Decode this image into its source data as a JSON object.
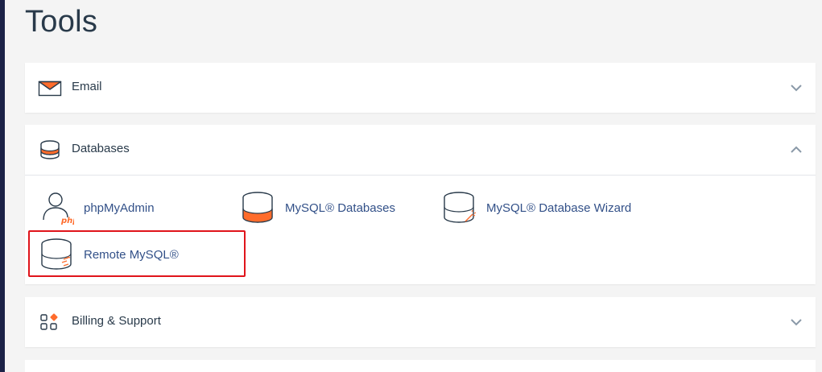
{
  "page": {
    "title": "Tools"
  },
  "colors": {
    "accent_orange": "#ff6c2c",
    "link_blue": "#325088",
    "highlight_red": "#e0141b",
    "left_rail": "#1c2247"
  },
  "sections": {
    "email": {
      "title": "Email",
      "icon": "envelope-icon",
      "state": "collapsed"
    },
    "databases": {
      "title": "Databases",
      "icon": "database-stack-icon",
      "state": "expanded",
      "tools": [
        {
          "label": "phpMyAdmin",
          "icon": "phpmyadmin-user-icon"
        },
        {
          "label": "MySQL® Databases",
          "icon": "mysql-databases-icon"
        },
        {
          "label": "MySQL® Database Wizard",
          "icon": "database-wizard-icon"
        },
        {
          "label": "Remote MySQL®",
          "icon": "remote-mysql-icon"
        }
      ]
    },
    "billing": {
      "title": "Billing & Support",
      "icon": "apps-grid-icon",
      "state": "collapsed"
    }
  }
}
